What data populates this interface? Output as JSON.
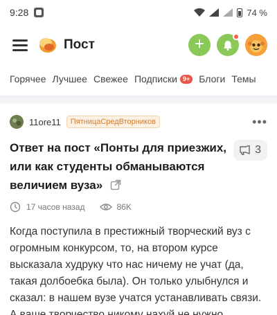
{
  "status_bar": {
    "time": "9:28",
    "battery": "74 %"
  },
  "header": {
    "title": "Пост"
  },
  "tabs": [
    {
      "label": "Горячее"
    },
    {
      "label": "Лучшее"
    },
    {
      "label": "Свежее"
    },
    {
      "label": "Подписки",
      "badge": "9+"
    },
    {
      "label": "Блоги"
    },
    {
      "label": "Темы"
    }
  ],
  "post": {
    "author": "11ore11",
    "community": "ПятницаСредВторников",
    "title": "Ответ на пост «Понты для приезжих, или как студенты обманываются величием вуза»",
    "comments_count": "3",
    "time_ago": "17 часов назад",
    "views": "86K",
    "body": "Когда поступила в престижный творческий вуз с огромным конкурсом, то, на втором курсе высказала худруку что нас ничему не учат (да, такая долбоебка была). Он только улыбнулся и сказал: в нашем вузе учатся устанавливать связи. А ваше творчество никому нахуй не нужно."
  },
  "colors": {
    "accent_green": "#8ac858",
    "badge_red": "#e8574a",
    "community_orange": "#d37b2e"
  },
  "icons": [
    "notification-icon",
    "wifi-icon",
    "signal-icon",
    "battery-icon",
    "menu-icon",
    "logo-icon",
    "plus-icon",
    "bell-icon",
    "clock-icon",
    "eye-icon",
    "external-link-icon",
    "comment-icon",
    "more-icon"
  ]
}
